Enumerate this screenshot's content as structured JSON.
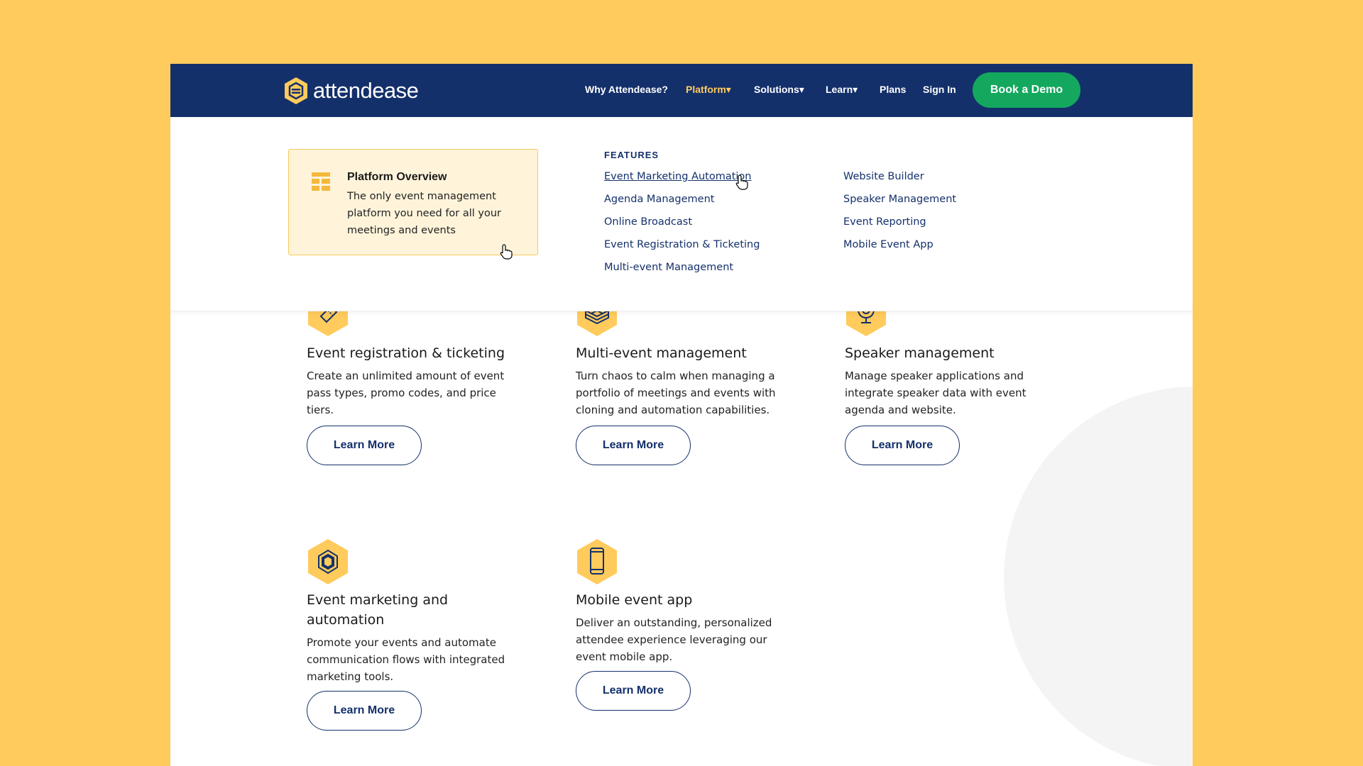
{
  "brand": {
    "name": "attendease",
    "logo_color": "#FFCB5C"
  },
  "nav": {
    "items": [
      {
        "label": "Why Attendease?"
      },
      {
        "label": "Platform▾"
      },
      {
        "label": "Solutions▾"
      },
      {
        "label": "Learn▾"
      },
      {
        "label": "Plans"
      },
      {
        "label": "Sign In"
      }
    ],
    "cta": "Book a Demo"
  },
  "dropdown": {
    "overview": {
      "title": "Platform Overview",
      "description": "The only event management platform you need for all your meetings and events",
      "icon": "grid-icon"
    },
    "features_heading": "FEATURES",
    "features_col1": [
      "Event Marketing Automation",
      "Agenda Management",
      "Online Broadcast",
      "Event Registration & Ticketing",
      "Multi-event Management"
    ],
    "features_col2": [
      "Website Builder",
      "Speaker Management",
      "Event Reporting",
      "Mobile Event App"
    ]
  },
  "cards": [
    {
      "icon": "ticket-icon",
      "title": "Event registration & ticketing",
      "description": "Create an unlimited amount of event pass types, promo codes, and price tiers.",
      "button": "Learn More"
    },
    {
      "icon": "layers-box-icon",
      "title": "Multi-event management",
      "description": "Turn chaos to calm when managing a portfolio of meetings and events with cloning and automation capabilities.",
      "button": "Learn More"
    },
    {
      "icon": "microphone-icon",
      "title": "Speaker management",
      "description": "Manage speaker applications and integrate speaker data with event agenda and website.",
      "button": "Learn More"
    },
    {
      "icon": "hexagon-automation-icon",
      "title": "Event marketing and automation",
      "description": "Promote your events and automate communication flows with integrated marketing tools.",
      "button": "Learn More"
    },
    {
      "icon": "mobile-phone-icon",
      "title": "Mobile event app",
      "description": "Deliver an outstanding, personalized attendee experience leveraging our event mobile app.",
      "button": "Learn More"
    }
  ],
  "colors": {
    "page_background": "#FFCB5C",
    "navbar": "#14306B",
    "cta_green": "#14A85F",
    "accent_yellow": "#FFCB5C",
    "overview_bg": "#FFF4DA"
  }
}
